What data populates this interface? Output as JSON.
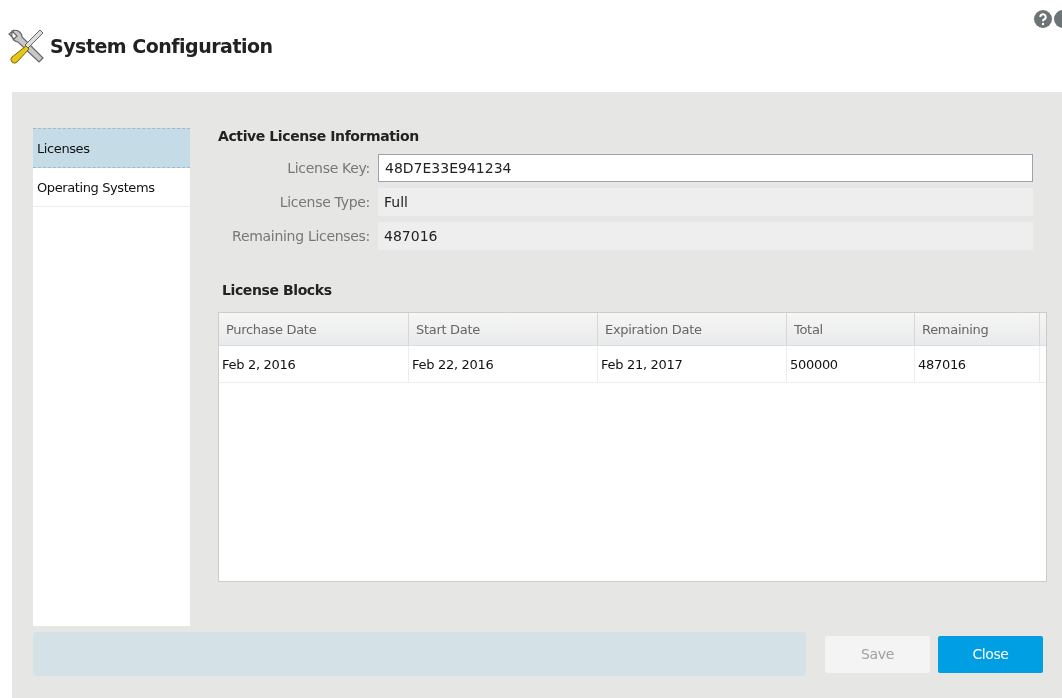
{
  "window": {
    "title": "System Configuration"
  },
  "sidebar": {
    "items": [
      {
        "label": "Licenses",
        "selected": true
      },
      {
        "label": "Operating Systems",
        "selected": false
      }
    ]
  },
  "license_info": {
    "title": "Active License Information",
    "fields": [
      {
        "label": "License Key:",
        "value": "48D7E33E941234",
        "kind": "input"
      },
      {
        "label": "License Type:",
        "value": "Full",
        "kind": "readonly"
      },
      {
        "label": "Remaining Licenses:",
        "value": "487016",
        "kind": "readonly"
      }
    ]
  },
  "license_blocks": {
    "title": "License Blocks",
    "columns": [
      "Purchase Date",
      "Start Date",
      "Expiration Date",
      "Total",
      "Remaining"
    ],
    "rows": [
      [
        "Feb 2, 2016",
        "Feb 22, 2016",
        "Feb 21, 2017",
        "500000",
        "487016"
      ]
    ]
  },
  "buttons": [
    {
      "label": "Save",
      "disabled": true,
      "primary": false
    },
    {
      "label": "Close",
      "disabled": false,
      "primary": true
    }
  ]
}
